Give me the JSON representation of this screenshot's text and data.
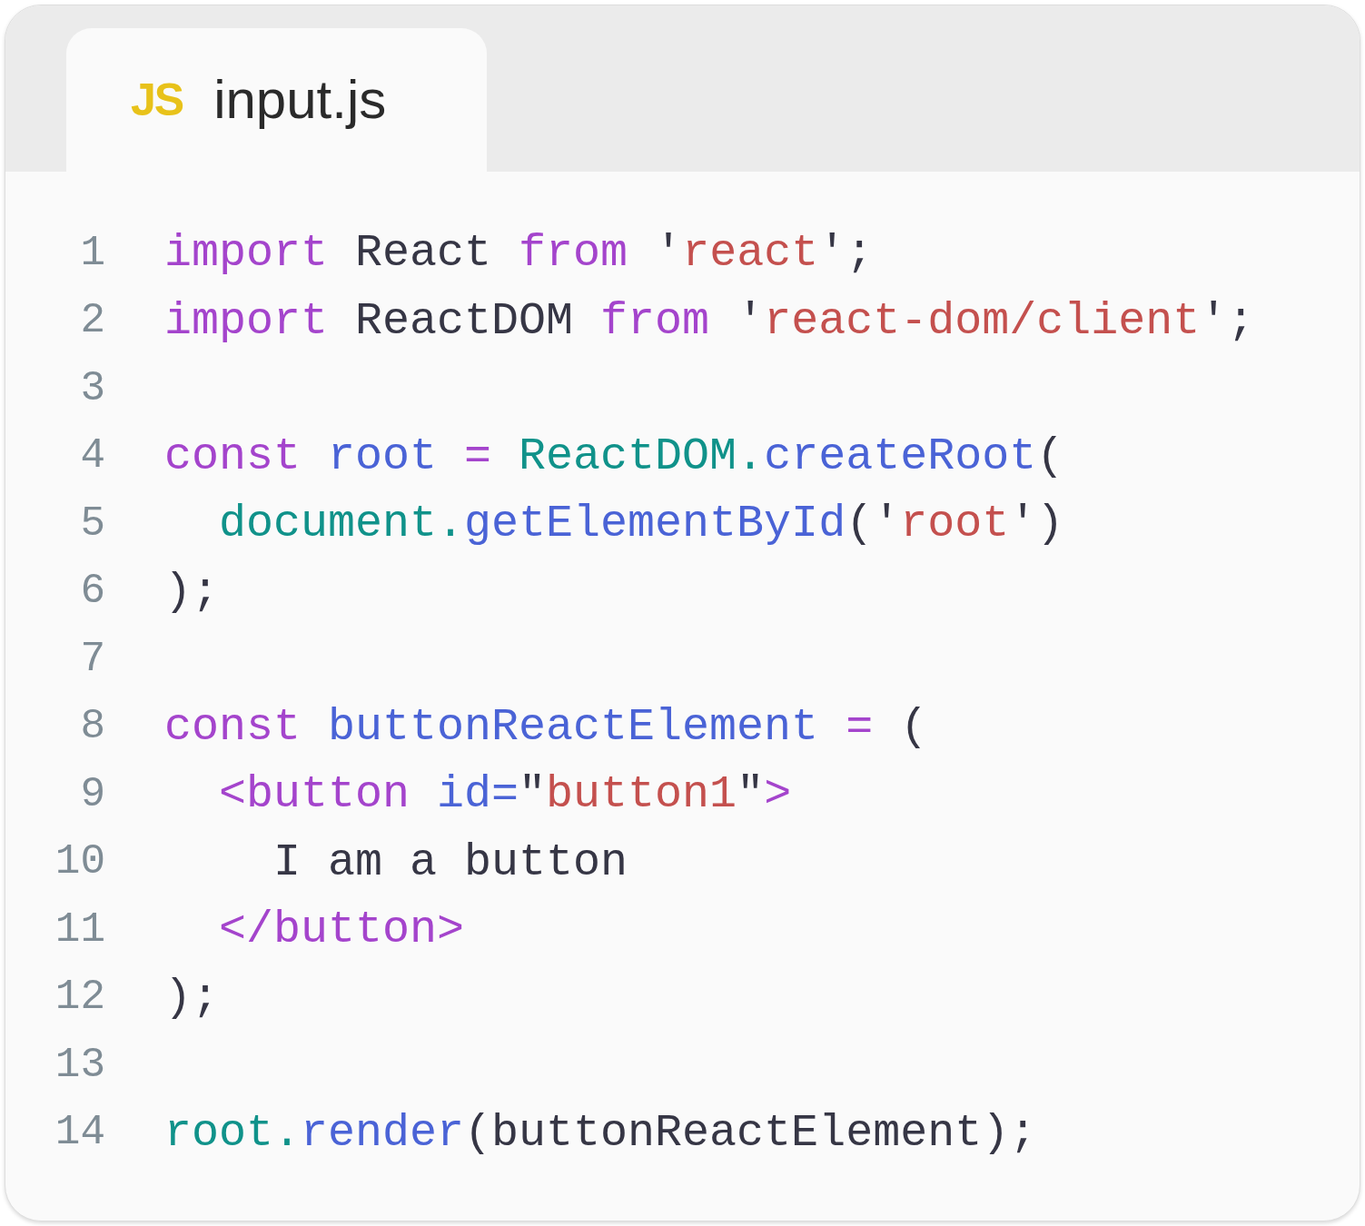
{
  "tabs": [
    {
      "icon_label": "JS",
      "label": "input.js",
      "selected": true
    }
  ],
  "lines": [
    {
      "number": "1",
      "tokens": [
        {
          "text": "import",
          "kind": "keyword"
        },
        {
          "text": " React ",
          "kind": "plain"
        },
        {
          "text": "from",
          "kind": "keyword"
        },
        {
          "text": " '",
          "kind": "plain"
        },
        {
          "text": "react",
          "kind": "string"
        },
        {
          "text": "';",
          "kind": "plain"
        }
      ]
    },
    {
      "number": "2",
      "tokens": [
        {
          "text": "import",
          "kind": "keyword"
        },
        {
          "text": " ReactDOM ",
          "kind": "plain"
        },
        {
          "text": "from",
          "kind": "keyword"
        },
        {
          "text": " '",
          "kind": "plain"
        },
        {
          "text": "react-dom/client",
          "kind": "string"
        },
        {
          "text": "';",
          "kind": "plain"
        }
      ]
    },
    {
      "number": "3"
    },
    {
      "number": "4",
      "tokens": [
        {
          "text": "const",
          "kind": "keyword"
        },
        {
          "text": " root",
          "kind": "variable"
        },
        {
          "text": " =",
          "kind": "keyword"
        },
        {
          "text": " ReactDOM.",
          "kind": "object"
        },
        {
          "text": "createRoot",
          "kind": "function"
        },
        {
          "text": "(",
          "kind": "plain"
        }
      ]
    },
    {
      "number": "5",
      "tokens": [
        {
          "text": "  document.",
          "kind": "object"
        },
        {
          "text": "getElementById",
          "kind": "function"
        },
        {
          "text": "('",
          "kind": "plain"
        },
        {
          "text": "root",
          "kind": "string"
        },
        {
          "text": "')",
          "kind": "plain"
        }
      ]
    },
    {
      "number": "6",
      "tokens": [
        {
          "text": ");",
          "kind": "plain"
        }
      ]
    },
    {
      "number": "7"
    },
    {
      "number": "8",
      "tokens": [
        {
          "text": "const",
          "kind": "keyword"
        },
        {
          "text": " buttonReactElement",
          "kind": "variable"
        },
        {
          "text": " =",
          "kind": "keyword"
        },
        {
          "text": " (",
          "kind": "plain"
        }
      ]
    },
    {
      "number": "9",
      "tokens": [
        {
          "text": "  <button",
          "kind": "tag"
        },
        {
          "text": " id=",
          "kind": "attribute"
        },
        {
          "text": "\"",
          "kind": "plain"
        },
        {
          "text": "button1",
          "kind": "string"
        },
        {
          "text": "\"",
          "kind": "plain"
        },
        {
          "text": ">",
          "kind": "tag"
        }
      ]
    },
    {
      "number": "10",
      "tokens": [
        {
          "text": "    I am a button",
          "kind": "plain"
        }
      ]
    },
    {
      "number": "11",
      "tokens": [
        {
          "text": "  </button>",
          "kind": "tag"
        }
      ]
    },
    {
      "number": "12",
      "tokens": [
        {
          "text": ");",
          "kind": "plain"
        }
      ]
    },
    {
      "number": "13"
    },
    {
      "number": "14",
      "tokens": [
        {
          "text": "root.",
          "kind": "object"
        },
        {
          "text": "render",
          "kind": "function"
        },
        {
          "text": "(buttonReactElement);",
          "kind": "plain"
        }
      ]
    }
  ]
}
